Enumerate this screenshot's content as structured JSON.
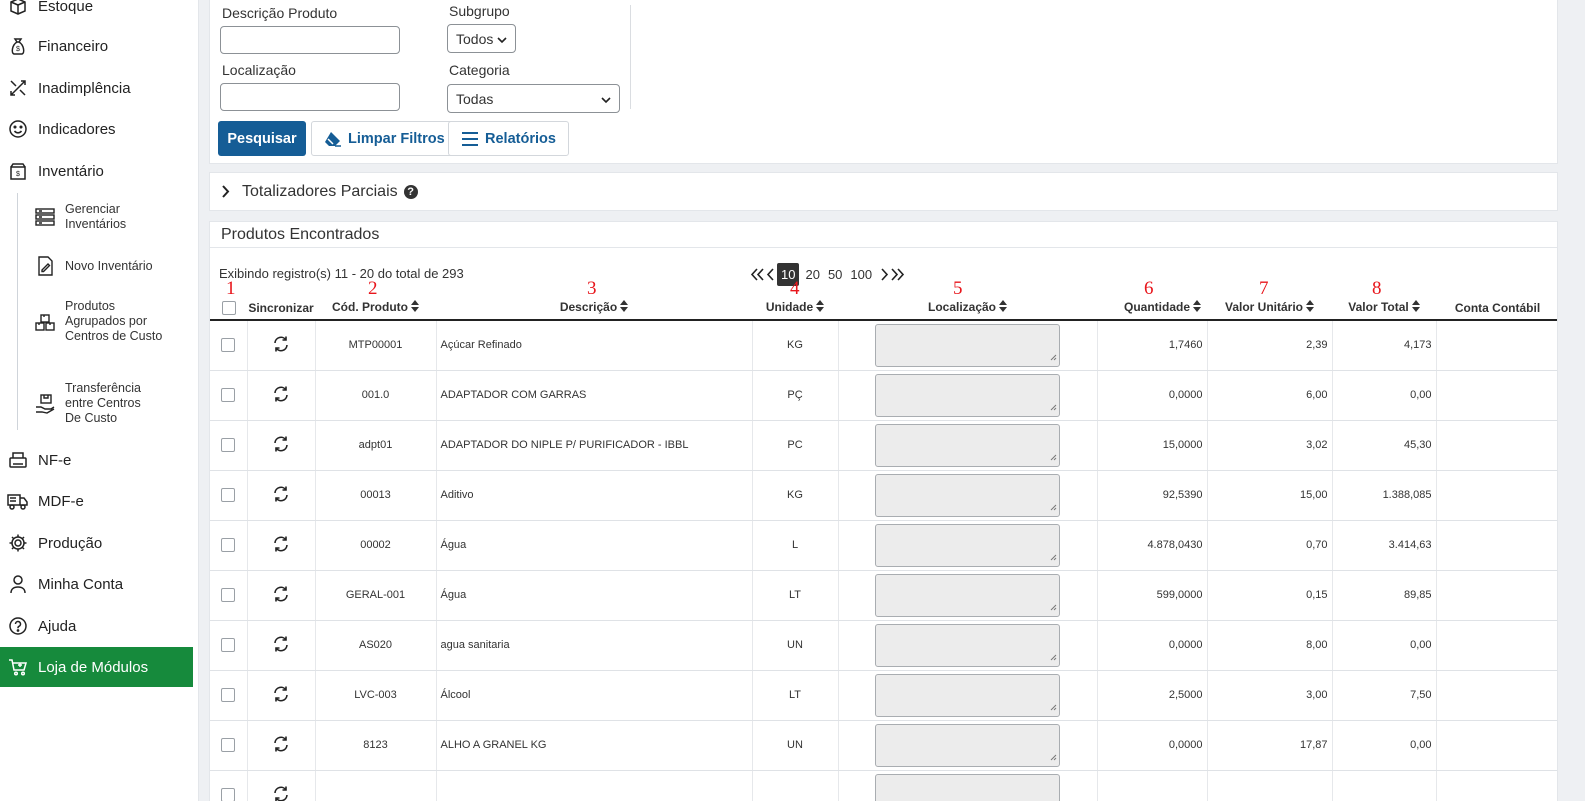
{
  "sidebar": {
    "items": [
      {
        "label": "Estoque",
        "icon": "box-icon"
      },
      {
        "label": "Financeiro",
        "icon": "money-bag-icon"
      },
      {
        "label": "Inadimplência",
        "icon": "tools-icon"
      },
      {
        "label": "Indicadores",
        "icon": "smiley-icon"
      },
      {
        "label": "Inventário",
        "icon": "inventory-box-icon"
      },
      {
        "label": "NF-e",
        "icon": "printer-icon"
      },
      {
        "label": "MDF-e",
        "icon": "truck-icon"
      },
      {
        "label": "Produção",
        "icon": "gear-icon"
      },
      {
        "label": "Minha Conta",
        "icon": "user-icon"
      },
      {
        "label": "Ajuda",
        "icon": "help-icon"
      },
      {
        "label": "Loja de Módulos",
        "icon": "cart-icon"
      }
    ],
    "sub_items": [
      {
        "label": "Gerenciar Inventários",
        "icon": "stack-icon"
      },
      {
        "label": "Novo Inventário",
        "icon": "edit-document-icon"
      },
      {
        "label": "Produtos Agrupados por Centros de Custo",
        "icon": "boxes-icon"
      },
      {
        "label": "Transferência entre Centros De Custo",
        "icon": "hand-box-icon"
      }
    ]
  },
  "filters": {
    "descricao_label": "Descrição Produto",
    "descricao_value": "",
    "localizacao_label": "Localização",
    "localizacao_value": "",
    "subgrupo_label": "Subgrupo",
    "subgrupo_value": "Todos",
    "categoria_label": "Categoria",
    "categoria_value": "Todas",
    "search_button": "Pesquisar",
    "clear_button": "Limpar Filtros",
    "reports_button": "Relatórios"
  },
  "totals": {
    "title": "Totalizadores Parciais"
  },
  "results": {
    "title": "Produtos Encontrados",
    "records_info": "Exibindo registro(s) 11 - 20 do total de 293",
    "page_sizes": [
      "10",
      "20",
      "50",
      "100"
    ],
    "selected_page_size": "10",
    "annotations": [
      "1",
      "2",
      "3",
      "4",
      "5",
      "6",
      "7",
      "8"
    ],
    "columns": [
      "Sincronizar",
      "Cód. Produto",
      "Descrição",
      "Unidade",
      "Localização",
      "Quantidade",
      "Valor Unitário",
      "Valor Total",
      "Conta Contábil"
    ],
    "rows": [
      {
        "codigo": "MTP00001",
        "descricao": "Açúcar Refinado",
        "unidade": "KG",
        "quantidade": "1,7460",
        "valor_unitario": "2,39",
        "valor_total": "4,173"
      },
      {
        "codigo": "001.0",
        "descricao": "ADAPTADOR COM GARRAS",
        "unidade": "PÇ",
        "quantidade": "0,0000",
        "valor_unitario": "6,00",
        "valor_total": "0,00"
      },
      {
        "codigo": "adpt01",
        "descricao": "ADAPTADOR DO NIPLE P/ PURIFICADOR - IBBL",
        "unidade": "PC",
        "quantidade": "15,0000",
        "valor_unitario": "3,02",
        "valor_total": "45,30"
      },
      {
        "codigo": "00013",
        "descricao": "Aditivo",
        "unidade": "KG",
        "quantidade": "92,5390",
        "valor_unitario": "15,00",
        "valor_total": "1.388,085"
      },
      {
        "codigo": "00002",
        "descricao": "Água",
        "unidade": "L",
        "quantidade": "4.878,0430",
        "valor_unitario": "0,70",
        "valor_total": "3.414,63"
      },
      {
        "codigo": "GERAL-001",
        "descricao": "Água",
        "unidade": "LT",
        "quantidade": "599,0000",
        "valor_unitario": "0,15",
        "valor_total": "89,85"
      },
      {
        "codigo": "AS020",
        "descricao": "agua sanitaria",
        "unidade": "UN",
        "quantidade": "0,0000",
        "valor_unitario": "8,00",
        "valor_total": "0,00"
      },
      {
        "codigo": "LVC-003",
        "descricao": "Álcool",
        "unidade": "LT",
        "quantidade": "2,5000",
        "valor_unitario": "3,00",
        "valor_total": "7,50"
      },
      {
        "codigo": "8123",
        "descricao": "ALHO A GRANEL KG",
        "unidade": "UN",
        "quantidade": "0,0000",
        "valor_unitario": "17,87",
        "valor_total": "0,00"
      },
      {
        "codigo": "",
        "descricao": "",
        "unidade": "",
        "quantidade": "",
        "valor_unitario": "",
        "valor_total": ""
      }
    ]
  },
  "colors": {
    "primary": "#155d96",
    "active_nav": "#168a3c",
    "annotation": "#e8161c"
  }
}
